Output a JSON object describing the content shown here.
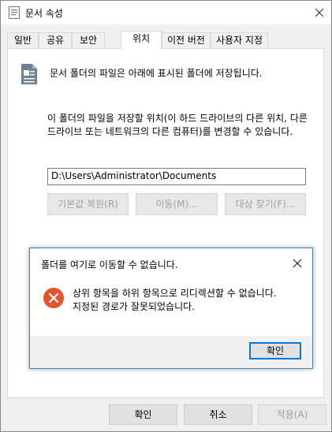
{
  "window": {
    "title": "문서 속성"
  },
  "tabs": [
    {
      "label": "일반"
    },
    {
      "label": "공유"
    },
    {
      "label": "보안"
    },
    {
      "label": "위치"
    },
    {
      "label": "이전 버전"
    },
    {
      "label": "사용자 지정"
    }
  ],
  "location": {
    "description": "문서 폴더의 파일은 아래에 표시된 폴더에 저장됩니다.",
    "info": "이 폴더의 파일을 저장할 위치(이 하드 드라이브의 다른 위치, 다른 드라이브 또는 네트워크의 다른 컴퓨터)를 변경할 수 있습니다.",
    "path": "D:\\Users\\Administrator\\Documents",
    "restore_default_label": "기본값 복원(R)",
    "move_label": "이동(M)...",
    "find_target_label": "대상 찾기(F)..."
  },
  "error_dialog": {
    "title": "폴더를 여기로 이동할 수 없습니다.",
    "message_line1": "상위 항목을 하위 항목으로 리디렉션할 수 없습니다.",
    "message_line2": "지정된 경로가 잘못되었습니다.",
    "ok_label": "확인"
  },
  "footer": {
    "ok_label": "확인",
    "cancel_label": "취소",
    "apply_label": "적용(A)"
  }
}
